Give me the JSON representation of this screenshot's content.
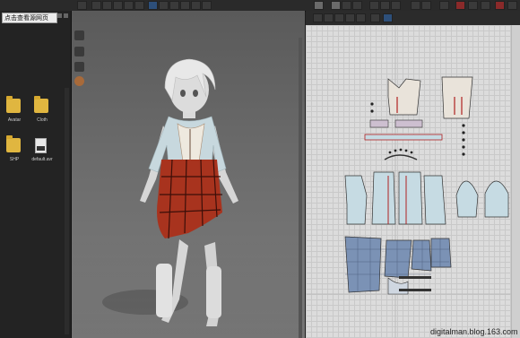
{
  "library": {
    "tooltip": "点击查看源网页",
    "files": [
      {
        "name": "Avatar",
        "icon": "folder-icon"
      },
      {
        "name": "Cloth",
        "icon": "folder-icon"
      },
      {
        "name": "SHP",
        "icon": "folder-icon"
      },
      {
        "name": "default.avr",
        "icon": "file-icon"
      }
    ]
  },
  "watermark": "digitalman.blog.163.com",
  "colors": {
    "background": "#1e1e1e",
    "skirt": "#a8331e",
    "shirt": "#c7d8de",
    "pattern_grid": "#dcdcdc",
    "pattern_piece": "#c6dbe3"
  }
}
